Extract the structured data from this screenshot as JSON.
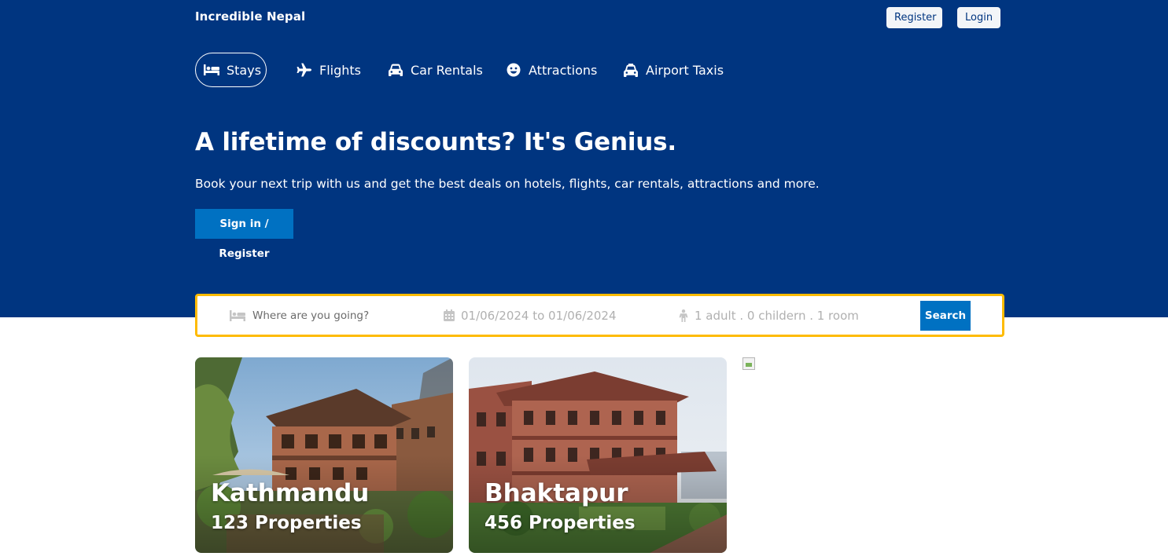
{
  "header": {
    "brand": "Incredible Nepal",
    "register_label": "Register",
    "login_label": "Login"
  },
  "nav": {
    "items": [
      {
        "label": "Stays",
        "icon": "bed-icon",
        "active": true
      },
      {
        "label": "Flights",
        "icon": "plane-icon",
        "active": false
      },
      {
        "label": "Car Rentals",
        "icon": "car-icon",
        "active": false
      },
      {
        "label": "Attractions",
        "icon": "smile-icon",
        "active": false
      },
      {
        "label": "Airport Taxis",
        "icon": "taxi-icon",
        "active": false
      }
    ]
  },
  "hero": {
    "title": "A lifetime of discounts? It's Genius.",
    "description": "Book your next trip with us and get the best deals on hotels, flights, car rentals, attractions and more.",
    "cta_label": "Sign in / Register"
  },
  "search": {
    "destination_placeholder": "Where are you going?",
    "dates": "01/06/2024 to 01/06/2024",
    "guests": "1 adult . 0 childern . 1 room",
    "button_label": "Search"
  },
  "featured": [
    {
      "city": "Kathmandu",
      "properties": "123 Properties"
    },
    {
      "city": "Bhaktapur",
      "properties": "456 Properties"
    }
  ],
  "colors": {
    "brand_blue": "#003580",
    "action_blue": "#0071c2",
    "search_border": "#febb02"
  }
}
